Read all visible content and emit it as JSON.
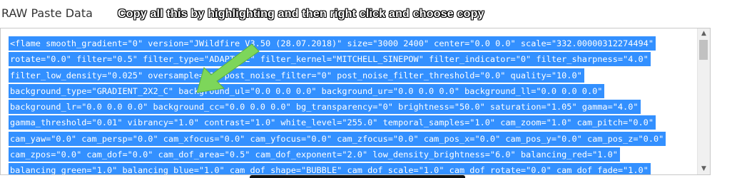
{
  "heading": "RAW Paste Data",
  "callout": "Copy all this by highlighting and then right click and choose copy",
  "paste_lines": [
    "<flame smooth_gradient=\"0\" version=\"JWildfire V3.50 (28.07.2018)\" size=\"3000 2400\" center=\"0.0 0.0\" scale=\"332.00000312274494\"",
    "rotate=\"0.0\" filter=\"0.5\" filter_type=\"ADAPTIVE\" filter_kernel=\"MITCHELL_SINEPOW\" filter_indicator=\"0\" filter_sharpness=\"4.0\"",
    "filter_low_density=\"0.025\" oversample=\"1\" post_noise_filter=\"0\" post_noise_filter_threshold=\"0.0\" quality=\"10.0\"",
    "background_type=\"GRADIENT_2X2_C\" background_ul=\"0.0 0.0 0.0\" background_ur=\"0.0 0.0 0.0\" background_ll=\"0.0 0.0 0.0\"",
    "background_lr=\"0.0 0.0 0.0\" background_cc=\"0.0 0.0 0.0\" bg_transparency=\"0\" brightness=\"50.0\" saturation=\"1.05\" gamma=\"4.0\"",
    "gamma_threshold=\"0.01\" vibrancy=\"1.0\" contrast=\"1.0\" white_level=\"255.0\" temporal_samples=\"1.0\" cam_zoom=\"1.0\" cam_pitch=\"0.0\"",
    "cam_yaw=\"0.0\" cam_persp=\"0.0\" cam_xfocus=\"0.0\" cam_yfocus=\"0.0\" cam_zfocus=\"0.0\" cam_pos_x=\"0.0\" cam_pos_y=\"0.0\" cam_pos_z=\"0.0\"",
    "cam_zpos=\"0.0\" cam_dof=\"0.0\" cam_dof_area=\"0.5\" cam_dof_exponent=\"2.0\" low_density_brightness=\"6.0\" balancing_red=\"1.0\"",
    "balancing_green=\"1.0\" balancing_blue=\"1.0\" cam_dof_shape=\"BUBBLE\" cam_dof_scale=\"1.0\" cam_dof_rotate=\"0.0\" cam_dof_fade=\"1.0\""
  ],
  "colors": {
    "selection": "#3390ff",
    "arrow": "#7dd65a"
  },
  "icons": {
    "scroll_up": "▲",
    "scroll_down": "▼"
  }
}
